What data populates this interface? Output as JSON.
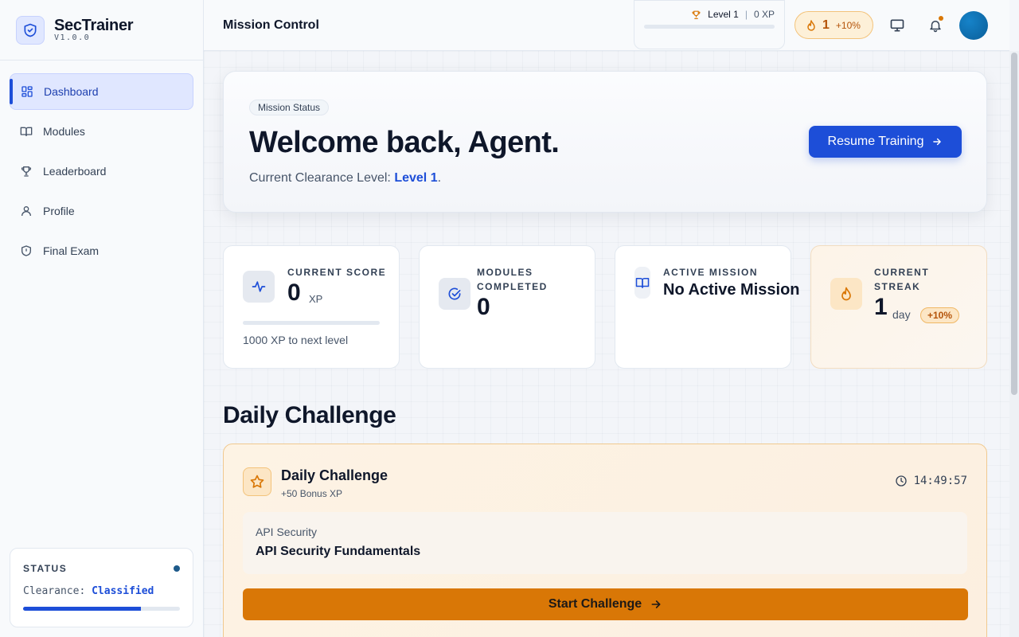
{
  "app": {
    "name": "SecTrainer",
    "version": "V1.0.0"
  },
  "sidebar": {
    "items": [
      {
        "label": "Dashboard",
        "icon": "dashboard-icon"
      },
      {
        "label": "Modules",
        "icon": "book-icon"
      },
      {
        "label": "Leaderboard",
        "icon": "trophy-icon"
      },
      {
        "label": "Profile",
        "icon": "user-icon"
      },
      {
        "label": "Final Exam",
        "icon": "shield-icon"
      }
    ],
    "status": {
      "title": "STATUS",
      "clearance_label": "Clearance:",
      "clearance_value": "Classified",
      "progress": 0.75
    }
  },
  "header": {
    "title": "Mission Control",
    "level": "Level 1",
    "xp": "0 XP",
    "streak_count": "1",
    "streak_bonus": "+10%"
  },
  "hero": {
    "chip": "Mission Status",
    "title": "Welcome back, Agent.",
    "subtitle_prefix": "Current Clearance Level:",
    "subtitle_level": "Level 1",
    "subtitle_suffix": ".",
    "button": "Resume Training"
  },
  "stats": {
    "score": {
      "label": "CURRENT SCORE",
      "value": "0",
      "unit": "XP",
      "note": "1000 XP to next level",
      "progress": 0
    },
    "modules": {
      "label_line1": "MODULES",
      "label_line2": "COMPLETED",
      "value": "0"
    },
    "mission": {
      "label": "ACTIVE MISSION",
      "value": "No Active Mission"
    },
    "streak": {
      "label_line1": "CURRENT",
      "label_line2": "STREAK",
      "value": "1",
      "unit": "day",
      "bonus": "+10%"
    }
  },
  "daily": {
    "section_title": "Daily Challenge",
    "title": "Daily Challenge",
    "bonus": "+50 Bonus XP",
    "timer": "14:49:57",
    "category": "API Security",
    "name": "API Security Fundamentals",
    "button": "Start Challenge"
  },
  "colors": {
    "accent": "#1d4ed8",
    "warning": "#d97706",
    "text": "#0f172a"
  }
}
